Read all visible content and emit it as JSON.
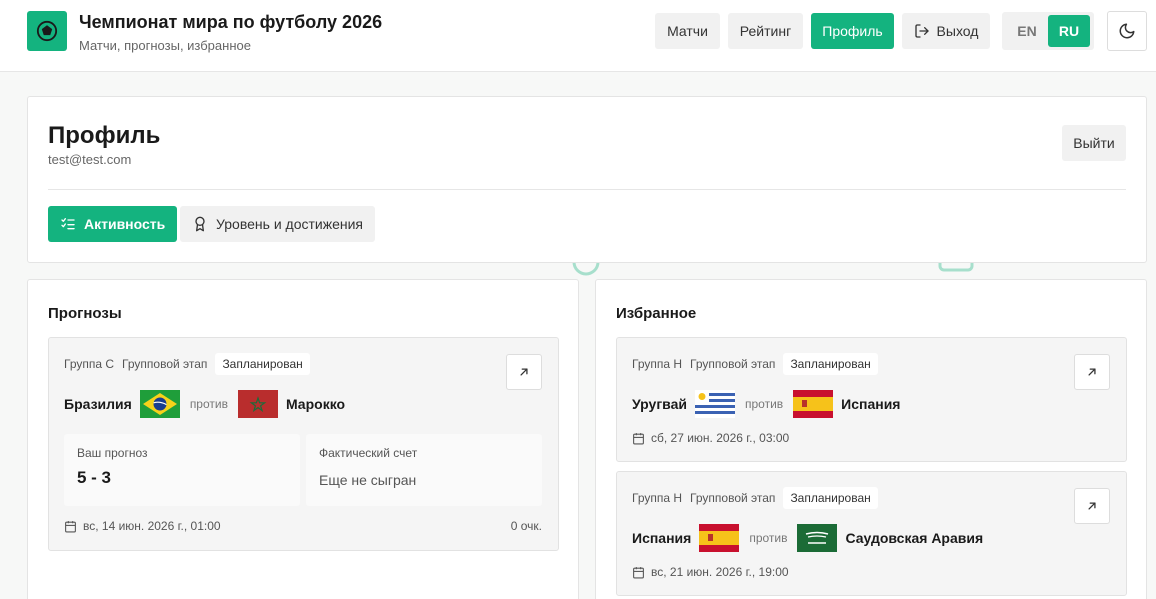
{
  "app": {
    "title": "Чемпионат мира по футболу 2026",
    "subtitle": "Матчи, прогнозы, избранное"
  },
  "nav": {
    "matches": "Матчи",
    "rating": "Рейтинг",
    "profile": "Профиль",
    "exit": "Выход"
  },
  "lang": {
    "en": "EN",
    "ru": "RU",
    "active": "RU"
  },
  "profile": {
    "title": "Профиль",
    "email": "test@test.com",
    "logout": "Выйти",
    "tabs": {
      "activity": "Активность",
      "achievements": "Уровень и достижения"
    }
  },
  "predictions": {
    "title": "Прогнозы",
    "items": [
      {
        "group": "Группа C",
        "stage": "Групповой этап",
        "status": "Запланирован",
        "home": "Бразилия",
        "vs": "против",
        "away": "Марокко",
        "your_prediction_label": "Ваш прогноз",
        "your_prediction": "5 - 3",
        "actual_label": "Фактический счет",
        "actual": "Еще не сыгран",
        "date": "вс, 14 июн. 2026 г., 01:00",
        "points": "0 очк."
      }
    ]
  },
  "favorites": {
    "title": "Избранное",
    "items": [
      {
        "group": "Группа H",
        "stage": "Групповой этап",
        "status": "Запланирован",
        "home": "Уругвай",
        "vs": "против",
        "away": "Испания",
        "date": "сб, 27 июн. 2026 г., 03:00"
      },
      {
        "group": "Группа H",
        "stage": "Групповой этап",
        "status": "Запланирован",
        "home": "Испания",
        "vs": "против",
        "away": "Саудовская Аравия",
        "date": "вс, 21 июн. 2026 г., 19:00"
      }
    ]
  },
  "colors": {
    "accent": "#14b37f"
  },
  "icons": [
    "soccer-ball-icon",
    "logout-icon",
    "moon-icon",
    "list-check-icon",
    "award-icon",
    "arrow-up-right-icon",
    "calendar-icon"
  ]
}
